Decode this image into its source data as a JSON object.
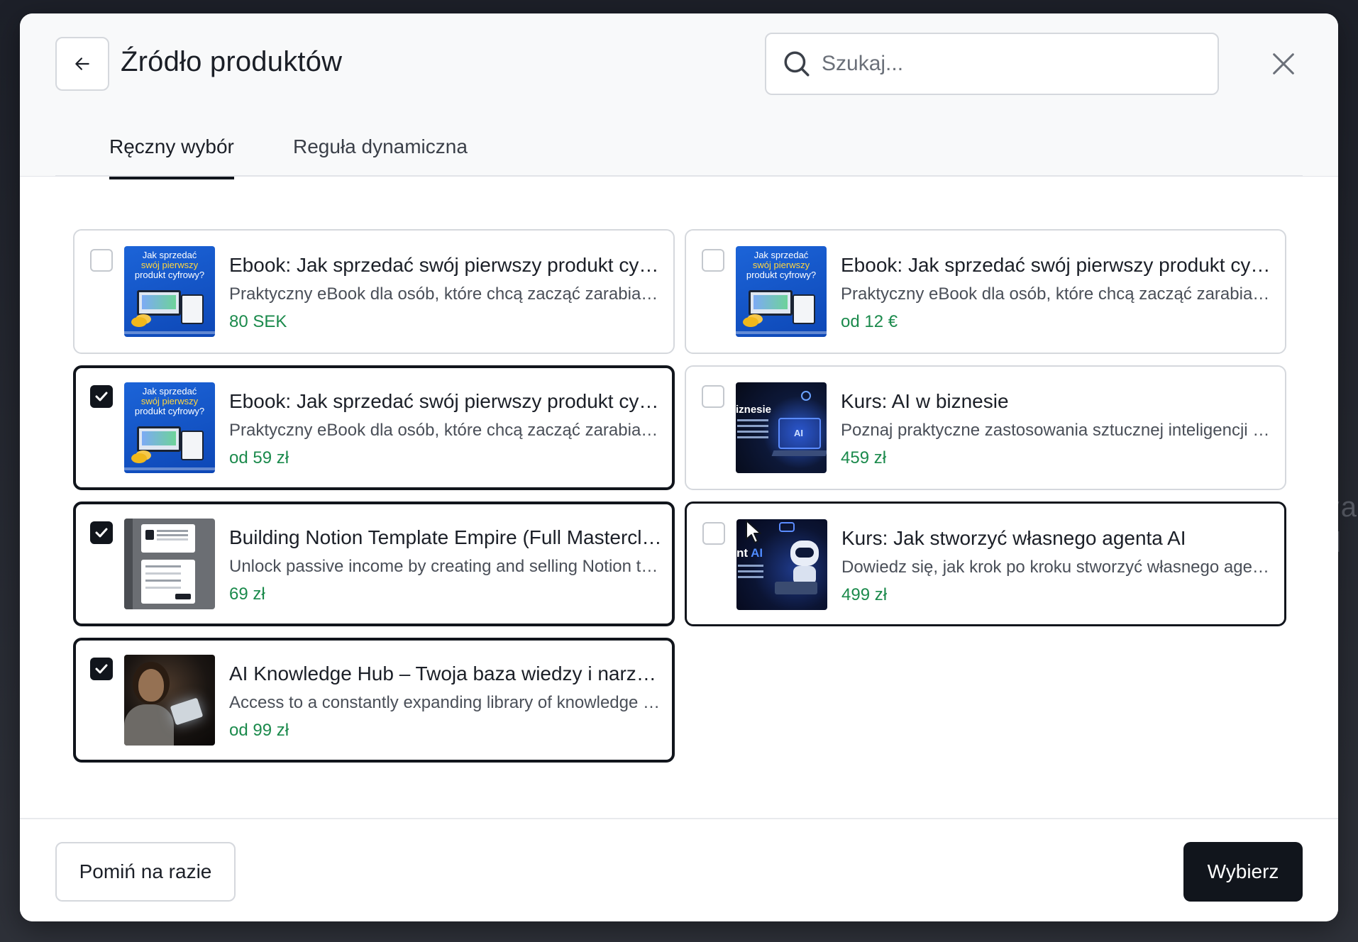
{
  "background": {
    "side_text": "l.\nva\nd"
  },
  "header": {
    "title": "Źródło produktów",
    "search_placeholder": "Szukaj...",
    "back_icon": "arrow-left-icon",
    "close_icon": "close-icon"
  },
  "tabs": [
    {
      "label": "Ręczny wybór",
      "active": true
    },
    {
      "label": "Reguła dynamiczna",
      "active": false
    }
  ],
  "products": [
    {
      "name": "Ebook: Jak sprzedać swój pierwszy produkt cyfrowy?",
      "description": "Praktyczny eBook dla osób, które chcą zacząć zarabiać w internecie",
      "price": "80 SEK",
      "checked": false,
      "thumb": "ebook"
    },
    {
      "name": "Ebook: Jak sprzedać swój pierwszy produkt cyfrowy?",
      "description": "Praktyczny eBook dla osób, które chcą zacząć zarabiać w internecie",
      "price": "od 12 €",
      "checked": false,
      "thumb": "ebook"
    },
    {
      "name": "Ebook: Jak sprzedać swój pierwszy produkt cyfrowy?",
      "description": "Praktyczny eBook dla osób, które chcą zacząć zarabiać w internecie",
      "price": "od 59 zł",
      "checked": true,
      "thumb": "ebook"
    },
    {
      "name": "Kurs: AI w biznesie",
      "description": "Poznaj praktyczne zastosowania sztucznej inteligencji w biznesie",
      "price": "459 zł",
      "checked": false,
      "thumb": "ai"
    },
    {
      "name": "Building Notion Template Empire (Full Masterclass)",
      "description": "Unlock passive income by creating and selling Notion templates",
      "price": "69 zł",
      "checked": true,
      "thumb": "notion"
    },
    {
      "name": "Kurs: Jak stworzyć własnego agenta AI",
      "description": "Dowiedz się, jak krok po kroku stworzyć własnego agenta AI",
      "price": "499 zł",
      "checked": false,
      "thumb": "agent"
    },
    {
      "name": "AI Knowledge Hub – Twoja baza wiedzy i narzędzi AI",
      "description": "Access to a constantly expanding library of knowledge and tools",
      "price": "od 99 zł",
      "checked": true,
      "thumb": "hub"
    }
  ],
  "thumb_text": {
    "ebook_line1": "Jak sprzedać",
    "ebook_line2": "swój pierwszy",
    "ebook_line3": "produkt cyfrowy?",
    "ai_label": "iznesie",
    "agent_label_a": "nt ",
    "agent_label_b": "AI"
  },
  "footer": {
    "skip_label": "Pomiń na razie",
    "choose_label": "Wybierz"
  },
  "colors": {
    "accent": "#11151c",
    "price": "#1b8a4c",
    "border": "#d5d8dd"
  }
}
